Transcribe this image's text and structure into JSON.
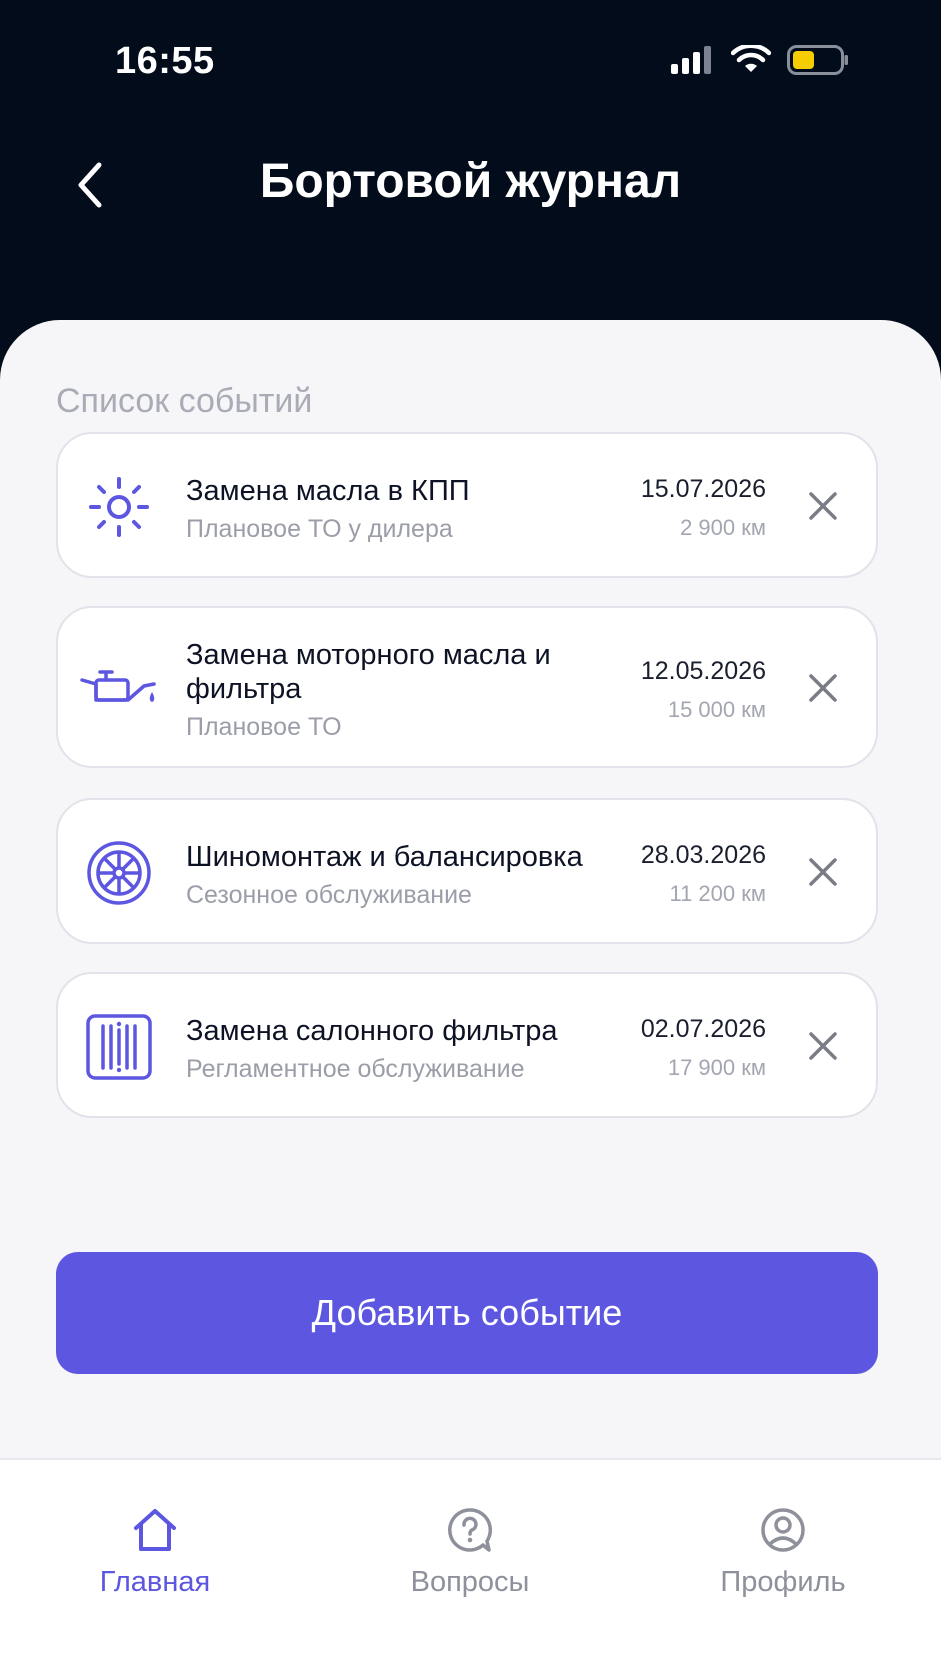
{
  "status_bar": {
    "time": "16:55"
  },
  "header": {
    "title": "Бортовой журнал"
  },
  "section_title": "Список событий",
  "events": [
    {
      "icon": "sun-gear-icon",
      "title": "Замена масла в КПП",
      "subtitle": "Плановое ТО у дилера",
      "date": "15.07.2026",
      "mileage": "2 900 км"
    },
    {
      "icon": "oil-can-icon",
      "title": "Замена моторного масла и фильтра",
      "subtitle": "Плановое ТО",
      "date": "12.05.2026",
      "mileage": "15 000 км"
    },
    {
      "icon": "wheel-icon",
      "title": "Шиномонтаж и балансировка",
      "subtitle": "Сезонное обслуживание",
      "date": "28.03.2026",
      "mileage": "11 200 км"
    },
    {
      "icon": "cabin-filter-icon",
      "title": "Замена салонного фильтра",
      "subtitle": "Регламентное обслуживание",
      "date": "02.07.2026",
      "mileage": "17 900 км"
    }
  ],
  "add_button_label": "Добавить событие",
  "nav": {
    "home": "Главная",
    "questions": "Вопросы",
    "profile": "Профиль"
  },
  "colors": {
    "accent": "#5c56e0",
    "header_bg": "#020c1b",
    "battery": "#f5cd00"
  }
}
